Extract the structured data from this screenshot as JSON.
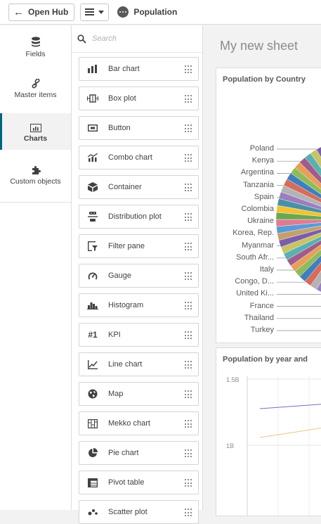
{
  "toolbar": {
    "open_hub_label": "Open Hub",
    "app_title": "Population"
  },
  "leftnav": {
    "items": [
      {
        "label": "Fields",
        "icon": "database-icon"
      },
      {
        "label": "Master items",
        "icon": "link-icon"
      },
      {
        "label": "Charts",
        "icon": "chart-icon",
        "active": true
      },
      {
        "label": "Custom objects",
        "icon": "puzzle-icon"
      }
    ]
  },
  "panel": {
    "search_placeholder": "Search",
    "charts": [
      {
        "label": "Bar chart",
        "icon": "bar-chart-icon"
      },
      {
        "label": "Box plot",
        "icon": "box-plot-icon"
      },
      {
        "label": "Button",
        "icon": "button-icon"
      },
      {
        "label": "Combo chart",
        "icon": "combo-chart-icon"
      },
      {
        "label": "Container",
        "icon": "container-icon"
      },
      {
        "label": "Distribution plot",
        "icon": "distribution-plot-icon"
      },
      {
        "label": "Filter pane",
        "icon": "filter-pane-icon"
      },
      {
        "label": "Gauge",
        "icon": "gauge-icon"
      },
      {
        "label": "Histogram",
        "icon": "histogram-icon"
      },
      {
        "label": "KPI",
        "icon": "kpi-icon",
        "glyph": "#1"
      },
      {
        "label": "Line chart",
        "icon": "line-chart-icon"
      },
      {
        "label": "Map",
        "icon": "map-icon"
      },
      {
        "label": "Mekko chart",
        "icon": "mekko-chart-icon"
      },
      {
        "label": "Pie chart",
        "icon": "pie-chart-icon"
      },
      {
        "label": "Pivot table",
        "icon": "pivot-table-icon"
      },
      {
        "label": "Scatter plot",
        "icon": "scatter-plot-icon"
      }
    ]
  },
  "sheet": {
    "title": "My new sheet",
    "card1": {
      "title": "Population by Country",
      "labels": [
        "Poland",
        "Kenya",
        "Argentina",
        "Tanzania",
        "Spain",
        "Colombia",
        "Ukraine",
        "Korea, Rep.",
        "Myanmar",
        "South Afr...",
        "Italy",
        "Congo, D...",
        "United Ki...",
        "France",
        "Thailand",
        "Turkey"
      ]
    },
    "card2": {
      "title": "Population by year and",
      "yticks": [
        "1.5B",
        "1B"
      ]
    }
  },
  "colors": {
    "accent": "#006580",
    "pie": [
      "#7b5ea7",
      "#c3a06e",
      "#5b9bd5",
      "#e07b91",
      "#6aa84f",
      "#f1c232",
      "#4a90a4",
      "#9a7fc0",
      "#b3b3b3",
      "#d86b5a",
      "#3f7fbf",
      "#8fbc5a",
      "#e5a05a",
      "#a05c8c",
      "#5ab0b0",
      "#c9c267"
    ]
  }
}
